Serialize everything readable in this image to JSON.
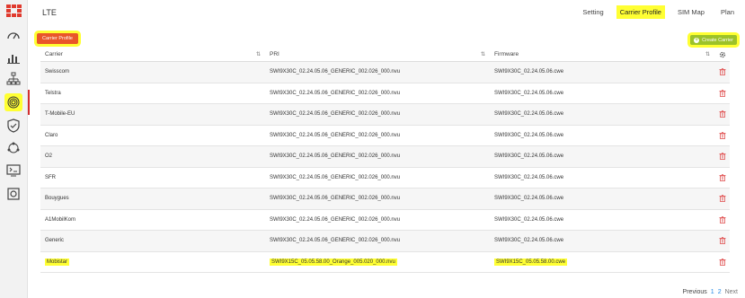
{
  "app": {
    "title": "LTE"
  },
  "tabs": [
    {
      "label": "Setting",
      "active": false
    },
    {
      "label": "Carrier Profile",
      "active": true
    },
    {
      "label": "SIM Map",
      "active": false
    },
    {
      "label": "Plan",
      "active": false
    }
  ],
  "section_pill": "Carrier Profile",
  "create_button": "Create Carrier",
  "table": {
    "headers": {
      "carrier": "Carrier",
      "pri": "PRI",
      "firmware": "Firmware"
    },
    "rows": [
      {
        "carrier": "Swisscom",
        "pri": "SWI9X30C_02.24.05.06_GENERIC_002.026_000.nvu",
        "firmware": "SWI9X30C_02.24.05.06.cwe"
      },
      {
        "carrier": "Telstra",
        "pri": "SWI9X30C_02.24.05.06_GENERIC_002.026_000.nvu",
        "firmware": "SWI9X30C_02.24.05.06.cwe"
      },
      {
        "carrier": "T-Mobile-EU",
        "pri": "SWI9X30C_02.24.05.06_GENERIC_002.026_000.nvu",
        "firmware": "SWI9X30C_02.24.05.06.cwe"
      },
      {
        "carrier": "Claro",
        "pri": "SWI9X30C_02.24.05.06_GENERIC_002.026_000.nvu",
        "firmware": "SWI9X30C_02.24.05.06.cwe"
      },
      {
        "carrier": "O2",
        "pri": "SWI9X30C_02.24.05.06_GENERIC_002.026_000.nvu",
        "firmware": "SWI9X30C_02.24.05.06.cwe"
      },
      {
        "carrier": "SFR",
        "pri": "SWI9X30C_02.24.05.06_GENERIC_002.026_000.nvu",
        "firmware": "SWI9X30C_02.24.05.06.cwe"
      },
      {
        "carrier": "Bouygues",
        "pri": "SWI9X30C_02.24.05.06_GENERIC_002.026_000.nvu",
        "firmware": "SWI9X30C_02.24.05.06.cwe"
      },
      {
        "carrier": "A1MobilKom",
        "pri": "SWI9X30C_02.24.05.06_GENERIC_002.026_000.nvu",
        "firmware": "SWI9X30C_02.24.05.06.cwe"
      },
      {
        "carrier": "Generic",
        "pri": "SWI9X30C_02.24.05.06_GENERIC_002.026_000.nvu",
        "firmware": "SWI9X30C_02.24.05.06.cwe"
      },
      {
        "carrier": "Mobistar",
        "pri": "SWI9X15C_05.05.58.00_Orange_005.020_000.nvu",
        "firmware": "SWI9X15C_05.05.58.00.cwe"
      }
    ]
  },
  "pagination": {
    "previous": "Previous",
    "page1": "1",
    "page2": "2",
    "next": "Next"
  },
  "colors": {
    "accent_red": "#d32f2f",
    "pill_orange": "#e9562a",
    "create_green": "#9cc229",
    "highlight_yellow": "#ffff33",
    "link_blue": "#1e88e5"
  },
  "icons": [
    "fortinet-logo-icon",
    "dashboard-gauge-icon",
    "bar-chart-icon",
    "network-topology-icon",
    "fingerprint-icon",
    "shield-icon",
    "nodes-icon",
    "terminal-icon",
    "settings-chip-icon",
    "sort-icon",
    "gear-icon",
    "trash-icon"
  ]
}
